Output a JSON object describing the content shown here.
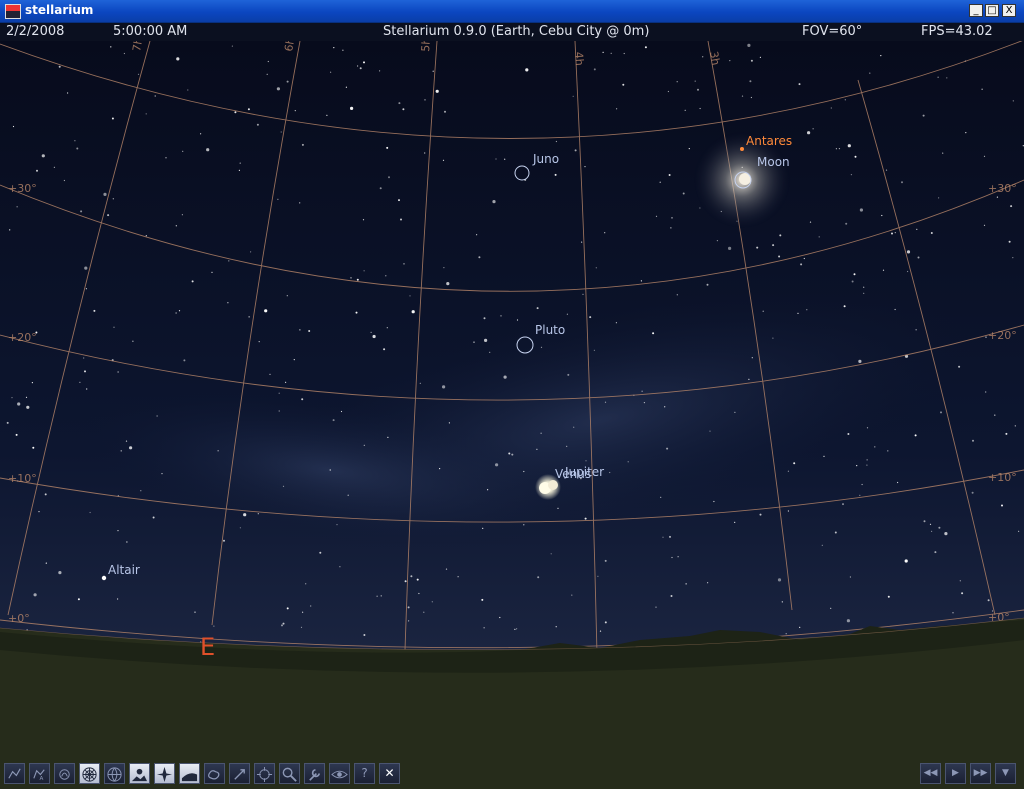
{
  "window": {
    "title": "stellarium",
    "controls": [
      "_",
      "□",
      "X"
    ]
  },
  "infobar": {
    "date": "2/2/2008",
    "time": "5:00:00 AM",
    "center": "Stellarium 0.9.0 (Earth, Cebu City @ 0m)",
    "fov": "FOV=60°",
    "fps": "FPS=43.02"
  },
  "sky": {
    "objects": {
      "juno": "Juno",
      "antares": "Antares",
      "moon": "Moon",
      "pluto": "Pluto",
      "venus": "Venus",
      "jupiter": "Jupiter",
      "altair": "Altair"
    },
    "cardinal": "E",
    "altitude_labels": [
      "+30°",
      "+20°",
      "+10°",
      "+0°"
    ],
    "ra_labels": [
      "7h",
      "6h",
      "5h",
      "4h",
      "3h"
    ],
    "colors": {
      "grid": "#b9876a",
      "label": "#b8c6e8",
      "antares": "#ff8a3a",
      "cardinal": "#e0502a",
      "ground": "#232a18"
    }
  },
  "toolbar": {
    "buttons": [
      {
        "name": "constellation-lines-button",
        "icon": "constellation-lines-icon",
        "on": false
      },
      {
        "name": "constellation-names-button",
        "icon": "constellation-names-icon",
        "on": false
      },
      {
        "name": "constellation-art-button",
        "icon": "constellation-art-icon",
        "on": false
      },
      {
        "name": "azimuthal-grid-button",
        "icon": "azimuthal-grid-icon",
        "on": true
      },
      {
        "name": "equatorial-grid-button",
        "icon": "equatorial-grid-icon",
        "on": false
      },
      {
        "name": "ground-button",
        "icon": "ground-icon",
        "on": true
      },
      {
        "name": "cardinal-points-button",
        "icon": "compass-icon",
        "on": true
      },
      {
        "name": "atmosphere-button",
        "icon": "atmosphere-icon",
        "on": true
      },
      {
        "name": "nebulae-button",
        "icon": "nebula-icon",
        "on": false
      },
      {
        "name": "equatorial-mount-button",
        "icon": "mount-icon",
        "on": false
      },
      {
        "name": "goto-button",
        "icon": "goto-icon",
        "on": false
      },
      {
        "name": "search-button",
        "icon": "magnifier-icon",
        "on": false
      },
      {
        "name": "config-button",
        "icon": "wrench-icon",
        "on": false
      },
      {
        "name": "night-mode-button",
        "icon": "eye-icon",
        "on": false
      },
      {
        "name": "help-button",
        "icon": "question-icon",
        "on": false,
        "glyph": "?"
      },
      {
        "name": "quit-button",
        "icon": "close-icon",
        "on": false,
        "glyph": "✕"
      }
    ]
  },
  "timebar": {
    "buttons": [
      {
        "name": "rewind-button",
        "icon": "rewind-icon",
        "glyph": "◀◀"
      },
      {
        "name": "real-time-button",
        "icon": "play-icon",
        "glyph": "▶"
      },
      {
        "name": "fast-forward-button",
        "icon": "fast-forward-icon",
        "glyph": "▶▶"
      },
      {
        "name": "now-button",
        "icon": "now-icon",
        "glyph": "▼"
      }
    ]
  }
}
